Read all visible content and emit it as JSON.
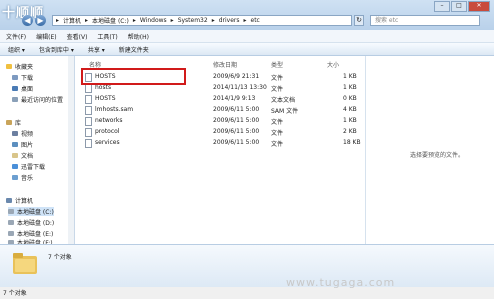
{
  "window": {
    "watermark_top": "十顺顺",
    "controls": {
      "minimize": "–",
      "maximize": "□",
      "close": "✕"
    }
  },
  "address_bar": {
    "segments": [
      "▸",
      "计算机",
      "▸",
      "本地磁盘 (C:)",
      "▸",
      "Windows",
      "▸",
      "System32",
      "▸",
      "drivers",
      "▸",
      "etc"
    ],
    "search_placeholder": "搜索 etc"
  },
  "menu": [
    "文件(F)",
    "编辑(E)",
    "查看(V)",
    "工具(T)",
    "帮助(H)"
  ],
  "toolbar": [
    "组织 ▾",
    "包含到库中 ▾",
    "共享 ▾",
    "新建文件夹"
  ],
  "nav": {
    "favorites": "收藏夹",
    "favorite_items": [
      "下载",
      "桌面",
      "最近访问的位置"
    ],
    "libraries": "库",
    "library_items": [
      "视频",
      "图片",
      "文档",
      "迅雷下载",
      "音乐"
    ],
    "computer": "计算机",
    "computer_items": [
      "本地磁盘 (C:)",
      "本地磁盘 (D:)",
      "本地磁盘 (E:)",
      "本地磁盘 (F:)"
    ]
  },
  "columns": [
    "名称",
    "修改日期",
    "类型",
    "大小"
  ],
  "files": [
    {
      "name": "HOSTS",
      "date": "2009/6/9 21:31",
      "type": "文件",
      "size": "1 KB"
    },
    {
      "name": "hosts",
      "date": "2014/11/13 13:30",
      "type": "文件",
      "size": "1 KB"
    },
    {
      "name": "HOSTS",
      "date": "2014/1/9 9:13",
      "type": "文本文档",
      "size": "0 KB"
    },
    {
      "name": "lmhosts.sam",
      "date": "2009/6/11 5:00",
      "type": "SAM 文件",
      "size": "4 KB"
    },
    {
      "name": "networks",
      "date": "2009/6/11 5:00",
      "type": "文件",
      "size": "1 KB"
    },
    {
      "name": "protocol",
      "date": "2009/6/11 5:00",
      "type": "文件",
      "size": "2 KB"
    },
    {
      "name": "services",
      "date": "2009/6/11 5:00",
      "type": "文件",
      "size": "18 KB"
    }
  ],
  "preview_text": "选择要预览的文件。",
  "details_count": "7 个对象",
  "status_count": "7 个对象",
  "watermark_bottom": "www.tugaga.com",
  "colors": {
    "highlight": "#d11a1a",
    "accent": "#3c6ea8"
  }
}
